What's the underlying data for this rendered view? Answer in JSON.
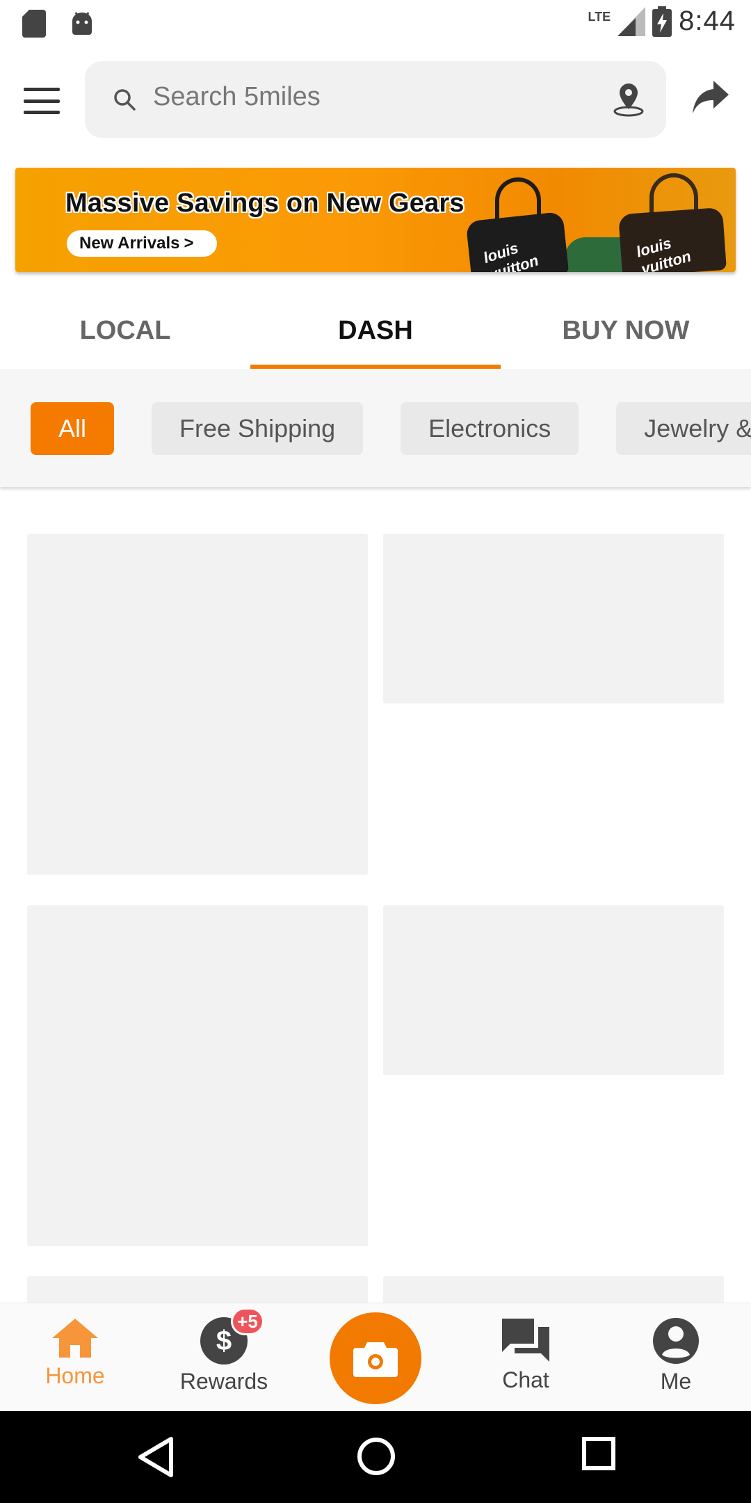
{
  "status_bar": {
    "time": "8:44",
    "network": "LTE",
    "icons": [
      "sd-card-icon",
      "android-icon",
      "lte-signal-icon",
      "battery-charging-icon"
    ]
  },
  "top_bar": {
    "menu_icon": "hamburger-menu-icon",
    "search_placeholder": "Search 5miles",
    "location_icon": "location-pin-icon",
    "share_icon": "share-arrow-icon"
  },
  "banner": {
    "title": "Massive Savings on New Gears",
    "cta": "New Arrivals",
    "cta_arrow": ">",
    "brand_text_1": "louis vuitton",
    "brand_text_2": "louis vuitton"
  },
  "tabs": [
    {
      "label": "LOCAL",
      "active": false
    },
    {
      "label": "DASH",
      "active": true
    },
    {
      "label": "BUY NOW",
      "active": false
    }
  ],
  "filter_chips": [
    {
      "label": "All",
      "active": true
    },
    {
      "label": "Free Shipping",
      "active": false
    },
    {
      "label": "Electronics",
      "active": false
    },
    {
      "label": "Jewelry &",
      "active": false
    }
  ],
  "bottom_nav": {
    "home": "Home",
    "rewards": "Rewards",
    "rewards_badge": "+5",
    "chat": "Chat",
    "me": "Me"
  },
  "colors": {
    "accent": "#f27a00",
    "home_active": "#f7953a",
    "badge": "#f0545b",
    "placeholder": "#f2f2f2"
  }
}
